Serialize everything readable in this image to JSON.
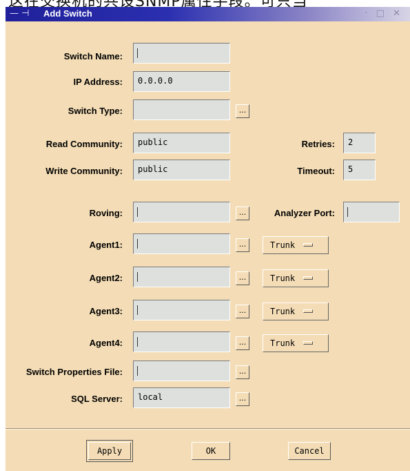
{
  "background_text": "这在交换机的共设SNMP属性手段。可只当",
  "window": {
    "title": "Add Switch",
    "controls_left": "— ⊣",
    "controls_right": "· □ ✕"
  },
  "form": {
    "switch_name": {
      "label": "Switch Name:",
      "value": ""
    },
    "ip_address": {
      "label": "IP Address:",
      "value": "0.0.0.0"
    },
    "switch_type": {
      "label": "Switch Type:",
      "value": ""
    },
    "read_community": {
      "label": "Read Community:",
      "value": "public"
    },
    "write_community": {
      "label": "Write Community:",
      "value": "public"
    },
    "retries": {
      "label": "Retries:",
      "value": "2"
    },
    "timeout": {
      "label": "Timeout:",
      "value": "5"
    },
    "roving": {
      "label": "Roving:",
      "value": ""
    },
    "analyzer_port": {
      "label": "Analyzer Port:",
      "value": ""
    },
    "agent1": {
      "label": "Agent1:",
      "value": "",
      "mode": "Trunk"
    },
    "agent2": {
      "label": "Agent2:",
      "value": "",
      "mode": "Trunk"
    },
    "agent3": {
      "label": "Agent3:",
      "value": "",
      "mode": "Trunk"
    },
    "agent4": {
      "label": "Agent4:",
      "value": "",
      "mode": "Trunk"
    },
    "switch_properties_file": {
      "label": "Switch Properties File:",
      "value": ""
    },
    "sql_server": {
      "label": "SQL Server:",
      "value": "local"
    },
    "browse_label": "..."
  },
  "buttons": {
    "apply": "Apply",
    "ok": "OK",
    "cancel": "Cancel"
  }
}
